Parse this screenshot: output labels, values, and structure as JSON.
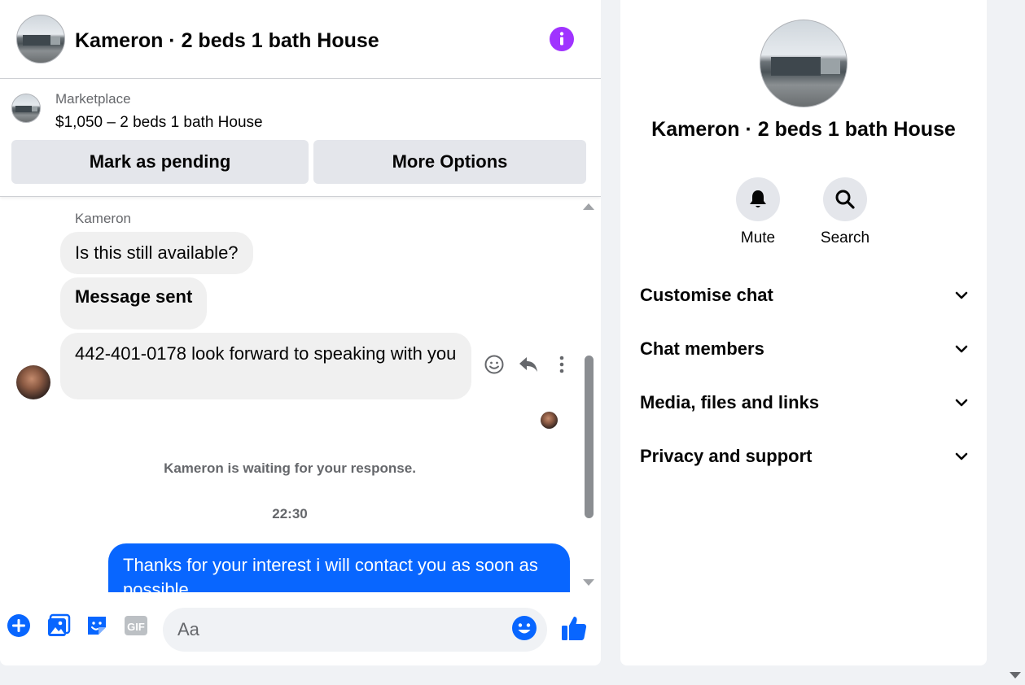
{
  "header": {
    "title": "Kameron · 2 beds 1 bath House",
    "info_icon": "info-icon",
    "accent_color": "#a033ff"
  },
  "listing": {
    "source": "Marketplace",
    "title": "$1,050 – 2 beds 1 bath House",
    "mark_pending_label": "Mark as pending",
    "more_options_label": "More Options"
  },
  "messages": {
    "sender": "Kameron",
    "incoming": [
      "Is this still available?",
      "Message sent",
      "442-401-0178 look forward to speaking with you"
    ],
    "waiting_note": "Kameron is waiting for your response.",
    "timestamp": "22:30",
    "outgoing": [
      "Thanks for your interest i will contact you as soon as possible"
    ],
    "outgoing_color": "#0866ff"
  },
  "composer": {
    "placeholder": "Aa",
    "icons": [
      "plus-icon",
      "photo-icon",
      "sticker-icon",
      "gif-icon",
      "emoji-icon",
      "thumbs-up-icon"
    ],
    "gif_label": "GIF"
  },
  "details": {
    "title": "Kameron · 2 beds 1 bath House",
    "actions": [
      {
        "label": "Mute",
        "icon": "bell-icon"
      },
      {
        "label": "Search",
        "icon": "search-icon"
      }
    ],
    "sections": [
      "Customise chat",
      "Chat members",
      "Media, files and links",
      "Privacy and support"
    ]
  }
}
